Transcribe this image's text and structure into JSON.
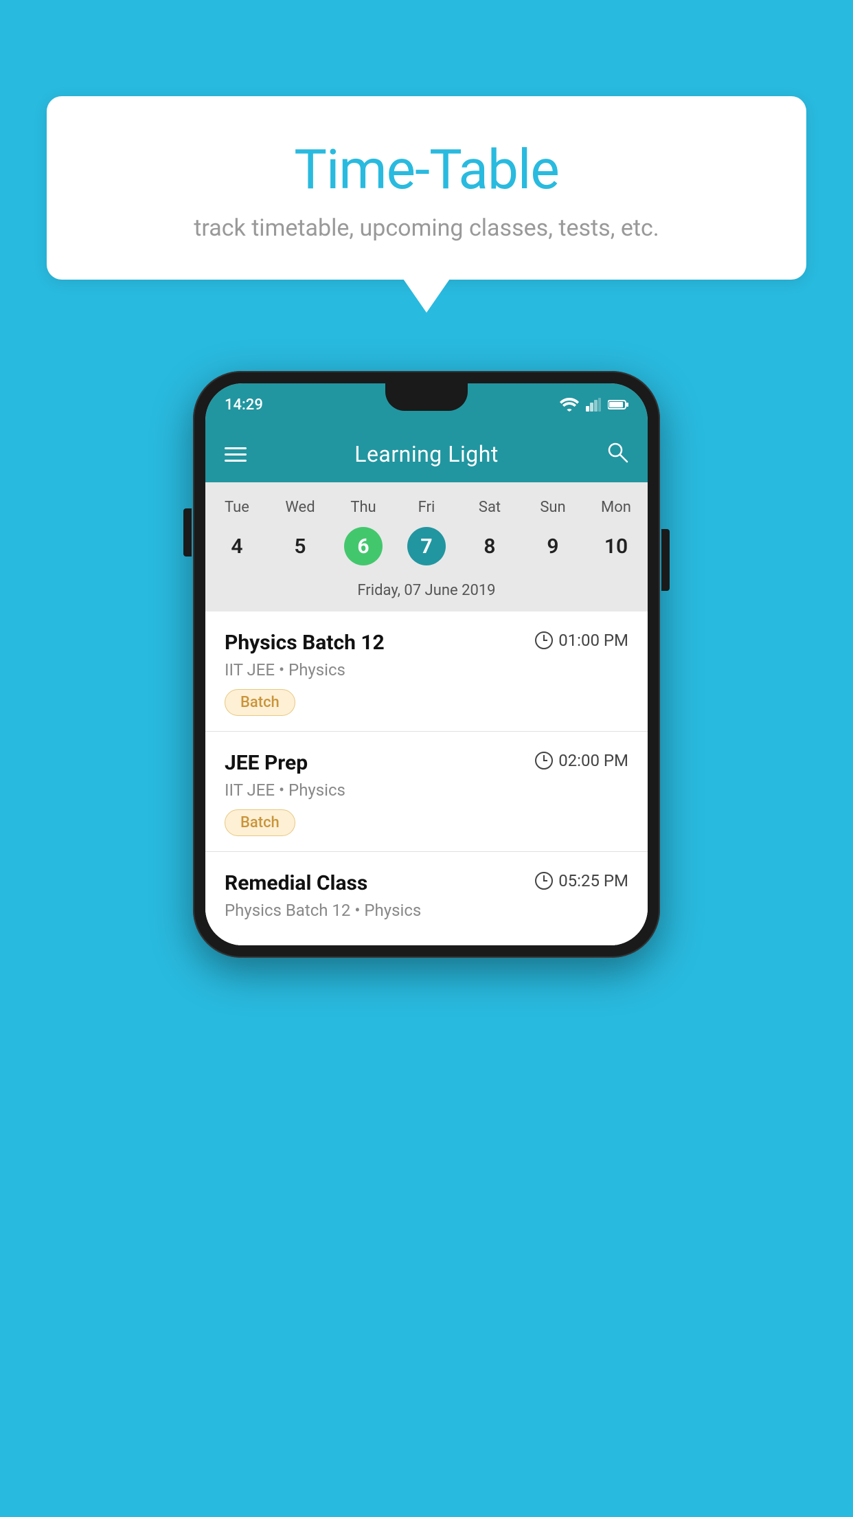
{
  "background_color": "#29BADF",
  "speech_bubble": {
    "title": "Time-Table",
    "subtitle": "track timetable, upcoming classes, tests, etc."
  },
  "phone": {
    "status_bar": {
      "time": "14:29"
    },
    "app_header": {
      "title": "Learning Light"
    },
    "calendar": {
      "days": [
        "Tue",
        "Wed",
        "Thu",
        "Fri",
        "Sat",
        "Sun",
        "Mon"
      ],
      "dates": [
        "4",
        "5",
        "6",
        "7",
        "8",
        "9",
        "10"
      ],
      "today_index": 2,
      "selected_index": 3,
      "selected_label": "Friday, 07 June 2019"
    },
    "schedule": [
      {
        "name": "Physics Batch 12",
        "time": "01:00 PM",
        "meta": "IIT JEE • Physics",
        "tag": "Batch"
      },
      {
        "name": "JEE Prep",
        "time": "02:00 PM",
        "meta": "IIT JEE • Physics",
        "tag": "Batch"
      },
      {
        "name": "Remedial Class",
        "time": "05:25 PM",
        "meta": "Physics Batch 12 • Physics",
        "tag": ""
      }
    ]
  }
}
